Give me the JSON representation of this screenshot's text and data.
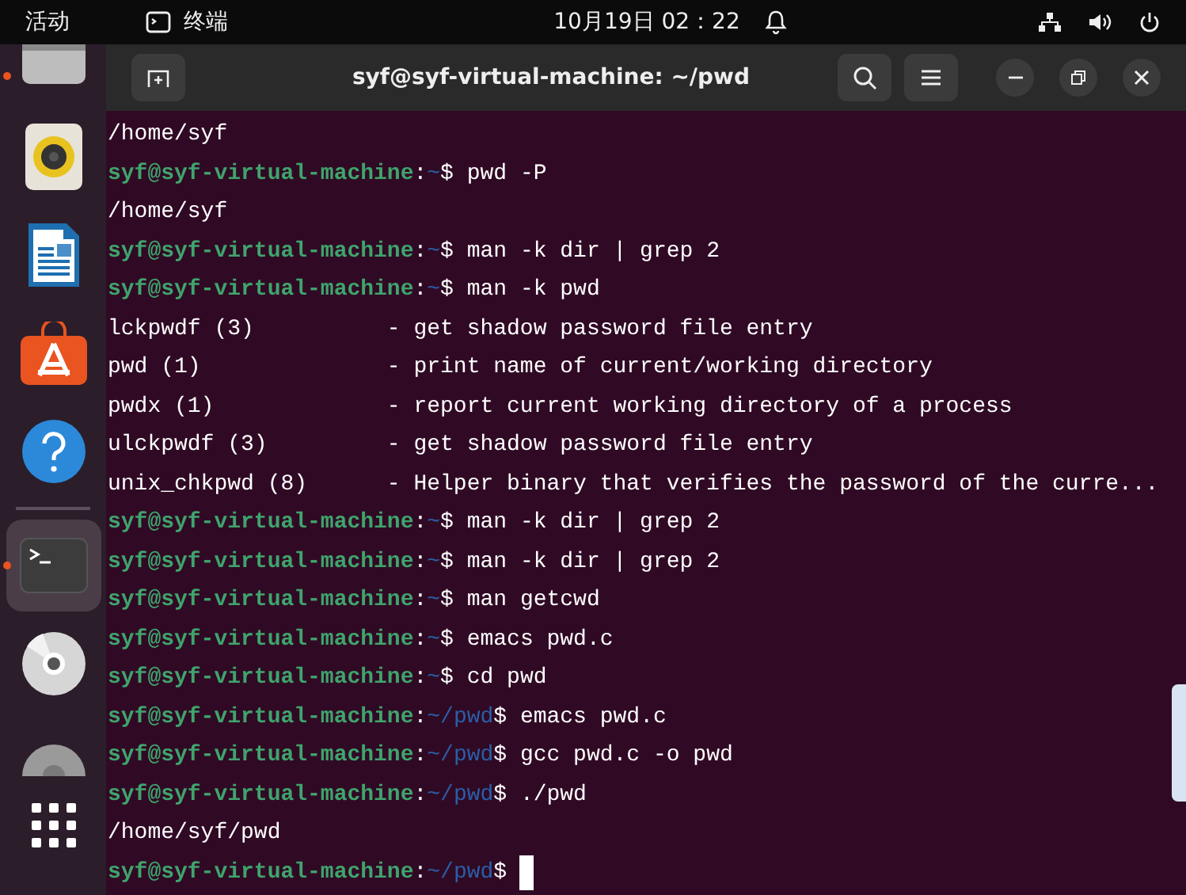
{
  "top_bar": {
    "activities": "活动",
    "app_name": "终端",
    "clock": "10月19日 02：22"
  },
  "dock": {
    "items": [
      {
        "kind": "drive",
        "running": true,
        "selected": false
      },
      {
        "kind": "speaker",
        "running": false,
        "selected": false
      },
      {
        "kind": "writer",
        "running": false,
        "selected": false
      },
      {
        "kind": "store",
        "running": false,
        "selected": false
      },
      {
        "kind": "help",
        "running": false,
        "selected": false
      },
      {
        "kind": "separator"
      },
      {
        "kind": "terminal",
        "running": true,
        "selected": true
      },
      {
        "kind": "disc",
        "running": false,
        "selected": false
      },
      {
        "kind": "disc-partial",
        "running": false,
        "selected": false
      },
      {
        "kind": "grid",
        "running": false,
        "selected": false
      }
    ]
  },
  "window": {
    "title": "syf@syf-virtual-machine: ~/pwd"
  },
  "terminal": {
    "lines": [
      {
        "kind": "output",
        "text": "/home/syf"
      },
      {
        "kind": "prompt",
        "user": "syf@syf-virtual-machine",
        "sep": ":",
        "path": "~",
        "sign": "$",
        "command": "pwd -P"
      },
      {
        "kind": "output",
        "text": "/home/syf"
      },
      {
        "kind": "prompt",
        "user": "syf@syf-virtual-machine",
        "sep": ":",
        "path": "~",
        "sign": "$",
        "command": "man -k dir | grep 2"
      },
      {
        "kind": "prompt",
        "user": "syf@syf-virtual-machine",
        "sep": ":",
        "path": "~",
        "sign": "$",
        "command": "man -k pwd"
      },
      {
        "kind": "entry",
        "name": "lckpwdf (3)",
        "description": "- get shadow password file entry"
      },
      {
        "kind": "entry",
        "name": "pwd (1)",
        "description": "- print name of current/working directory"
      },
      {
        "kind": "entry",
        "name": "pwdx (1)",
        "description": "- report current working directory of a process"
      },
      {
        "kind": "entry",
        "name": "ulckpwdf (3)",
        "description": "- get shadow password file entry"
      },
      {
        "kind": "entry",
        "name": "unix_chkpwd (8)",
        "description": "- Helper binary that verifies the password of the curre..."
      },
      {
        "kind": "prompt",
        "user": "syf@syf-virtual-machine",
        "sep": ":",
        "path": "~",
        "sign": "$",
        "command": "man -k dir | grep 2"
      },
      {
        "kind": "prompt",
        "user": "syf@syf-virtual-machine",
        "sep": ":",
        "path": "~",
        "sign": "$",
        "command": "man -k dir | grep 2"
      },
      {
        "kind": "prompt",
        "user": "syf@syf-virtual-machine",
        "sep": ":",
        "path": "~",
        "sign": "$",
        "command": "man getcwd"
      },
      {
        "kind": "prompt",
        "user": "syf@syf-virtual-machine",
        "sep": ":",
        "path": "~",
        "sign": "$",
        "command": "emacs pwd.c"
      },
      {
        "kind": "prompt",
        "user": "syf@syf-virtual-machine",
        "sep": ":",
        "path": "~",
        "sign": "$",
        "command": "cd pwd"
      },
      {
        "kind": "prompt",
        "user": "syf@syf-virtual-machine",
        "sep": ":",
        "path": "~/pwd",
        "sign": "$",
        "command": "emacs pwd.c"
      },
      {
        "kind": "prompt",
        "user": "syf@syf-virtual-machine",
        "sep": ":",
        "path": "~/pwd",
        "sign": "$",
        "command": "gcc pwd.c -o pwd"
      },
      {
        "kind": "prompt",
        "user": "syf@syf-virtual-machine",
        "sep": ":",
        "path": "~/pwd",
        "sign": "$",
        "command": "./pwd"
      },
      {
        "kind": "output",
        "text": "/home/syf/pwd"
      },
      {
        "kind": "prompt",
        "user": "syf@syf-virtual-machine",
        "sep": ":",
        "path": "~/pwd",
        "sign": "$",
        "cursor": true
      }
    ]
  }
}
